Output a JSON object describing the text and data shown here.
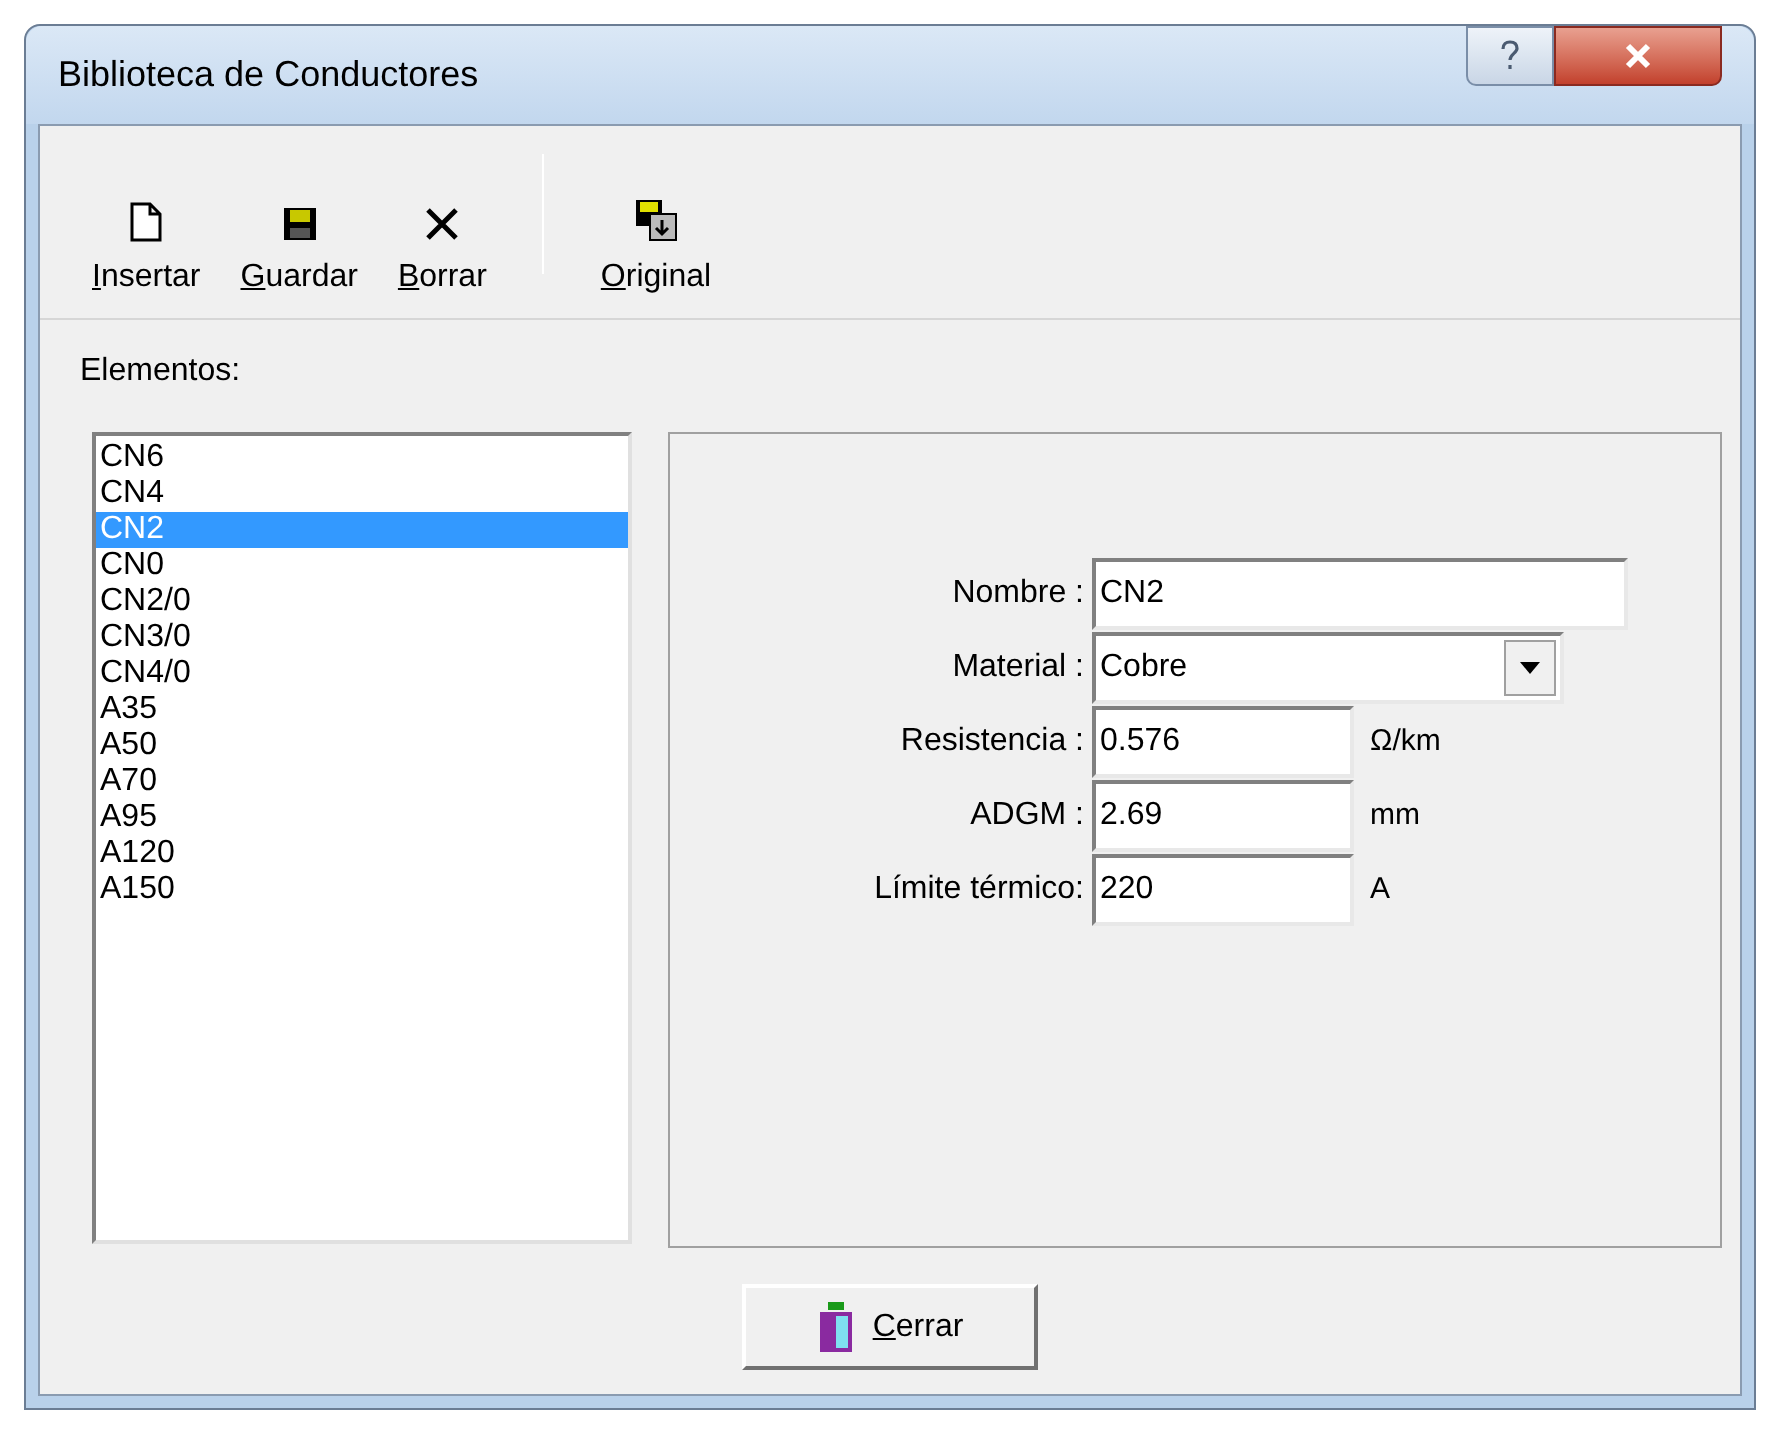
{
  "window": {
    "title": "Biblioteca de Conductores"
  },
  "toolbar": [
    {
      "label": "Insertar",
      "kind": "new"
    },
    {
      "label": "Guardar",
      "kind": "save"
    },
    {
      "label": "Borrar",
      "kind": "delete"
    },
    {
      "label": "Original",
      "kind": "restore"
    }
  ],
  "list_label": "Elementos:",
  "elements": [
    {
      "label": "CN6",
      "selected": false
    },
    {
      "label": "CN4",
      "selected": false
    },
    {
      "label": "CN2",
      "selected": true
    },
    {
      "label": "CN0",
      "selected": false
    },
    {
      "label": "CN2/0",
      "selected": false
    },
    {
      "label": "CN3/0",
      "selected": false
    },
    {
      "label": "CN4/0",
      "selected": false
    },
    {
      "label": "A35",
      "selected": false
    },
    {
      "label": "A50",
      "selected": false
    },
    {
      "label": "A70",
      "selected": false
    },
    {
      "label": "A95",
      "selected": false
    },
    {
      "label": "A120",
      "selected": false
    },
    {
      "label": "A150",
      "selected": false
    }
  ],
  "fields": [
    {
      "label": "Nombre :",
      "value": "CN2",
      "kind": "text"
    },
    {
      "label": "Material :",
      "value": "Cobre",
      "kind": "select"
    },
    {
      "label": "Resistencia :",
      "value": "0.576",
      "unit": "Ω/km",
      "kind": "number"
    },
    {
      "label": "ADGM :",
      "value": "2.69",
      "unit": "mm",
      "kind": "number"
    },
    {
      "label": "Límite térmico:",
      "value": "220",
      "unit": "A",
      "kind": "number"
    }
  ],
  "close_button": "Cerrar"
}
